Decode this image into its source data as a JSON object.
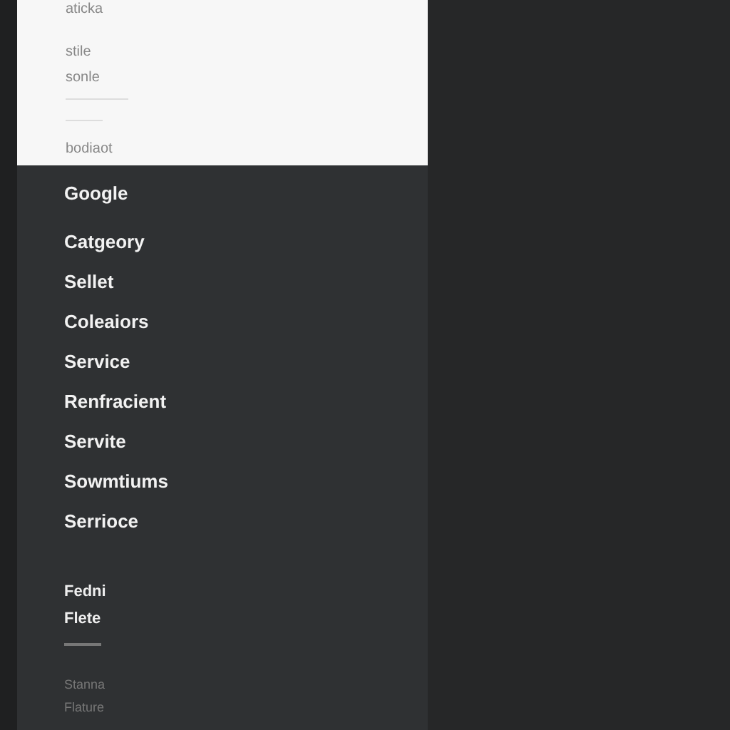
{
  "header": {
    "items": [
      "aticka",
      "stile",
      "sonle"
    ],
    "footer": "bodiaot"
  },
  "menu": {
    "items": [
      "Google",
      "Catgeory",
      "Sellet",
      "Coleaiors",
      "Service",
      "Renfracient",
      "Servite",
      "Sowmtiums",
      "Serrioce"
    ]
  },
  "extra": {
    "items": [
      "Fedni",
      "Flete"
    ]
  },
  "footer": {
    "items": [
      "Stanna",
      "Flature"
    ]
  }
}
